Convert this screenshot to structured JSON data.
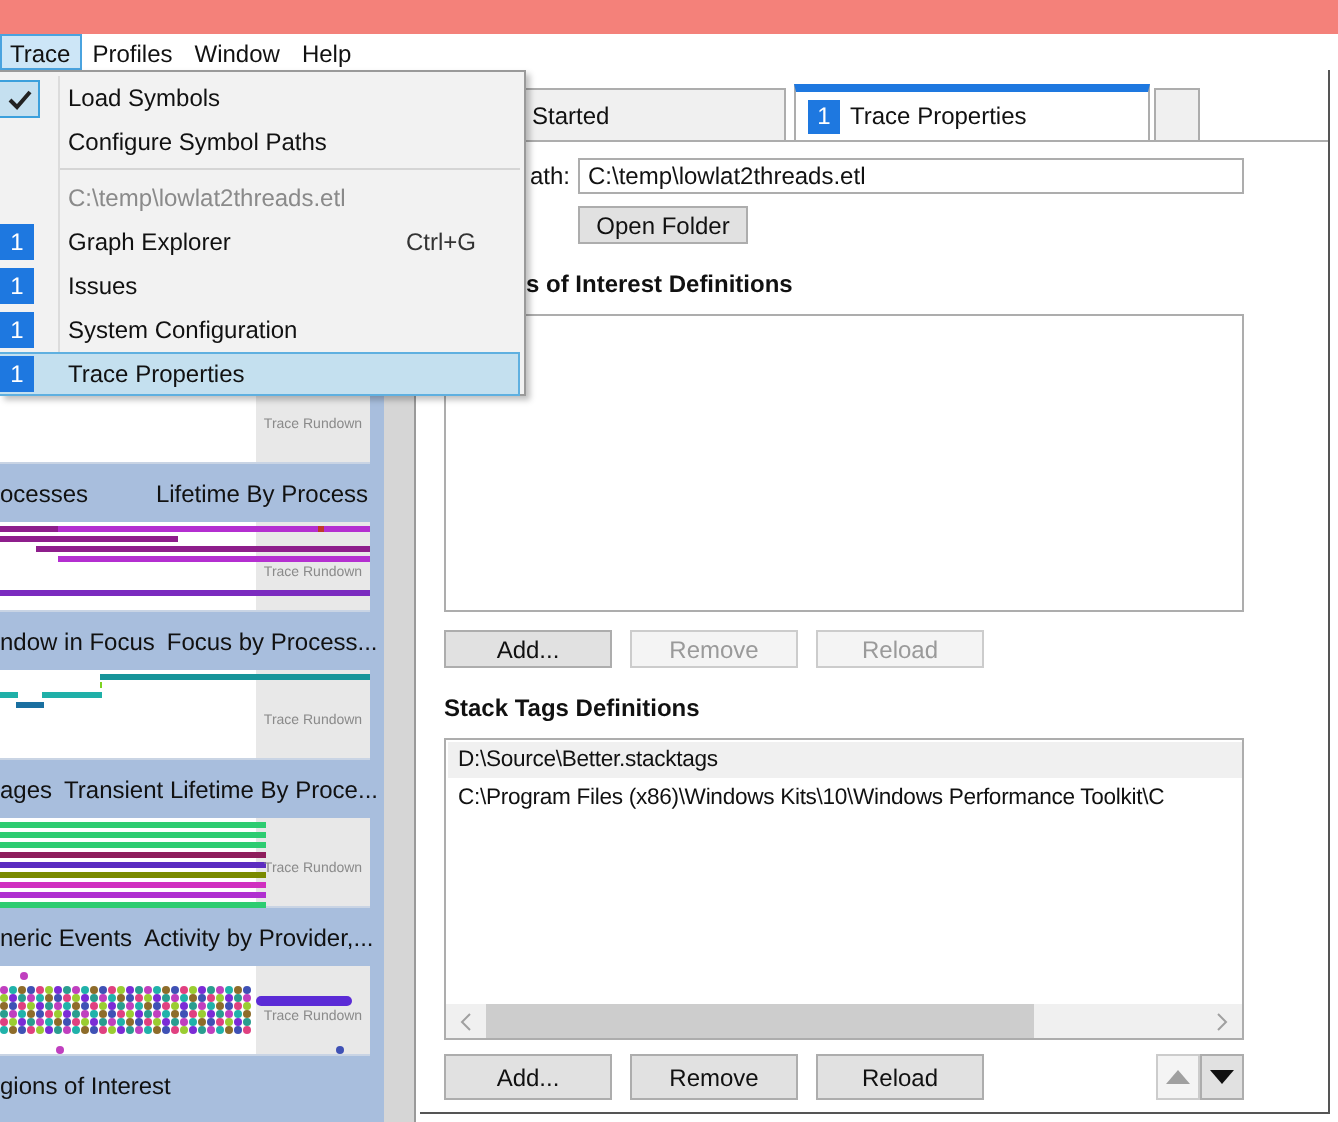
{
  "menu_bar": [
    {
      "label": "Trace",
      "selected": true
    },
    {
      "label": "Profiles",
      "selected": false
    },
    {
      "label": "Window",
      "selected": false
    },
    {
      "label": "Help",
      "selected": false
    }
  ],
  "trace_menu": [
    {
      "kind": "item",
      "label": "Load Symbols",
      "checked": true,
      "selected": false
    },
    {
      "kind": "item",
      "label": "Configure Symbol Paths",
      "checked": false,
      "selected": false
    },
    {
      "kind": "separator"
    },
    {
      "kind": "header",
      "label": "C:\\temp\\lowlat2threads.etl"
    },
    {
      "kind": "item",
      "badge": "1",
      "label": "Graph Explorer",
      "shortcut": "Ctrl+G",
      "checked": false,
      "selected": false
    },
    {
      "kind": "item",
      "badge": "1",
      "label": "Issues",
      "checked": false,
      "selected": false
    },
    {
      "kind": "item",
      "badge": "1",
      "label": "System Configuration",
      "checked": false,
      "selected": false
    },
    {
      "kind": "item",
      "badge": "1",
      "label": "Trace Properties",
      "checked": false,
      "selected": true
    }
  ],
  "graph_thumbnails": [
    {
      "kind": "blank",
      "note": "Trace Rundown"
    },
    {
      "kind": "lifetime",
      "category": "ocesses",
      "title": "Lifetime By Process",
      "note": "Trace Rundown"
    },
    {
      "kind": "focus",
      "category": "ndow in Focus",
      "title": "Focus by Process...",
      "note": "Trace Rundown"
    },
    {
      "kind": "transient",
      "category": "ages",
      "title": "Transient Lifetime By Proce...",
      "note": "Trace Rundown"
    },
    {
      "kind": "events",
      "category": "neric Events",
      "title": "Activity by Provider,...",
      "note": "Trace Rundown"
    },
    {
      "category": "gions of Interest"
    }
  ],
  "tabs": [
    {
      "label": "Started",
      "selected": false
    },
    {
      "badge": "1",
      "label": "Trace Properties",
      "selected": true
    },
    {
      "selected": false
    }
  ],
  "trace_path": {
    "label": "ath:",
    "value": "C:\\temp\\lowlat2threads.etl",
    "button": "Open Folder"
  },
  "regions_of_interest": {
    "heading": "s of Interest Definitions",
    "buttons": [
      {
        "label": "Add...",
        "disabled": false
      },
      {
        "label": "Remove",
        "disabled": true
      },
      {
        "label": "Reload",
        "disabled": true
      }
    ]
  },
  "stack_tags": {
    "heading": "Stack Tags Definitions",
    "items": [
      {
        "label": "D:\\Source\\Better.stacktags",
        "selected": true
      },
      {
        "label": "C:\\Program Files (x86)\\Windows Kits\\10\\Windows Performance Toolkit\\C",
        "selected": false
      }
    ],
    "buttons": [
      {
        "label": "Add...",
        "disabled": false
      },
      {
        "label": "Remove",
        "disabled": false
      },
      {
        "label": "Reload",
        "disabled": false
      }
    ],
    "move_buttons": [
      {
        "kind": "up",
        "disabled": true
      },
      {
        "kind": "down",
        "disabled": false
      }
    ]
  }
}
